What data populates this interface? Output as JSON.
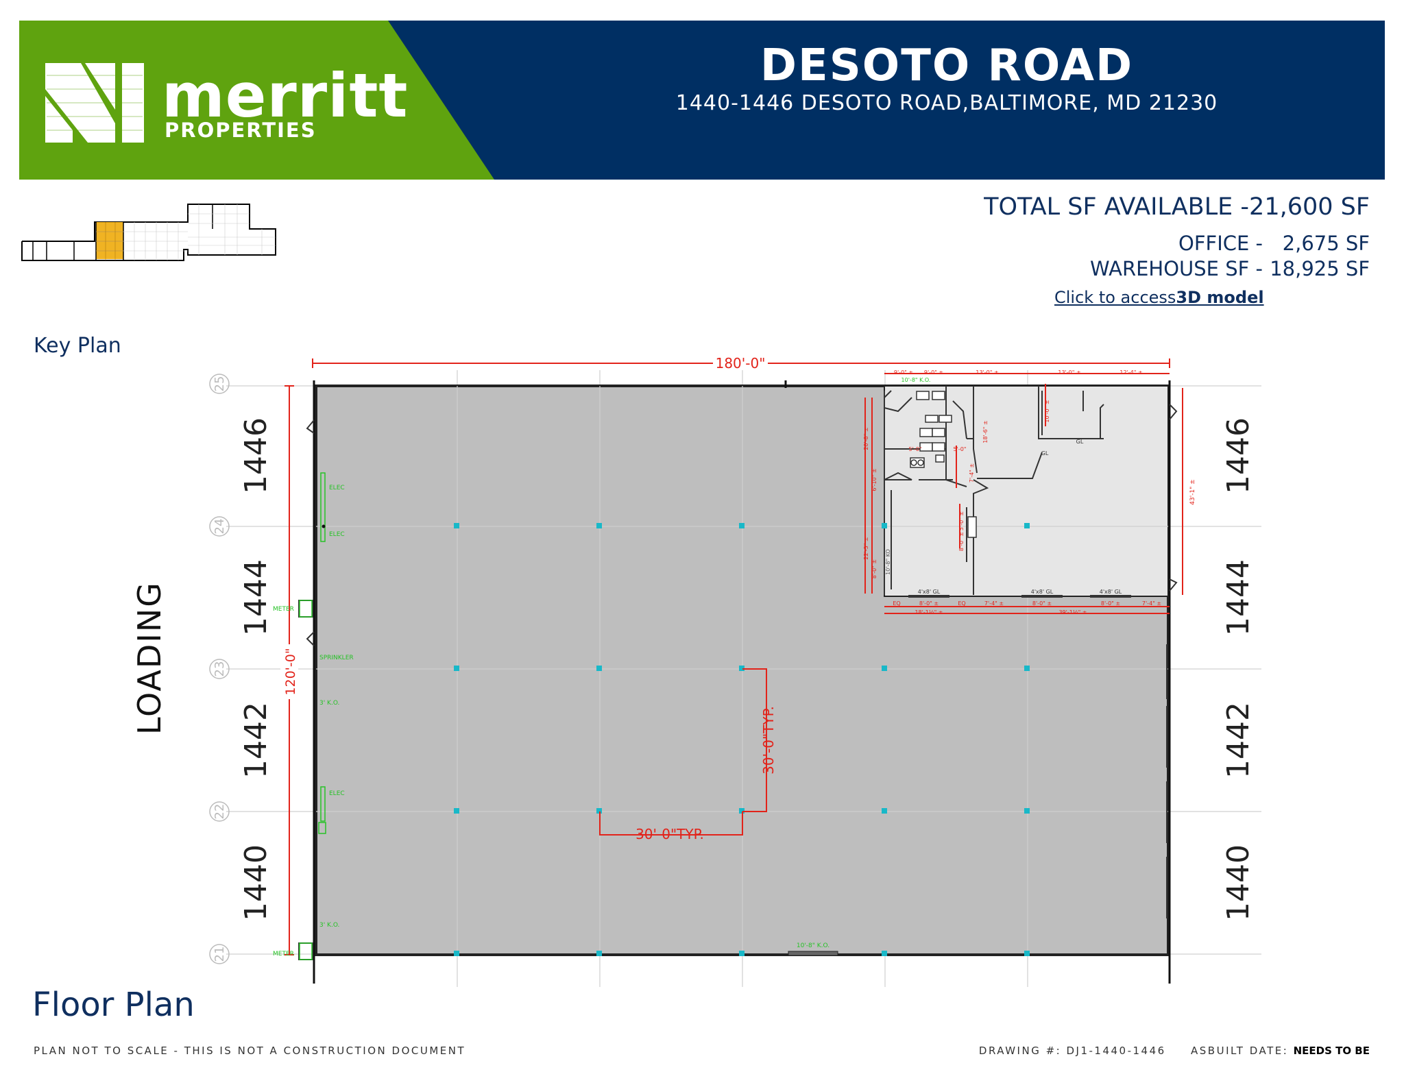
{
  "header": {
    "brand_name": "merritt",
    "brand_sub": "PROPERTIES",
    "title": "DESOTO ROAD",
    "address": "1440-1446 DESOTO ROAD,BALTIMORE, MD  21230",
    "colors": {
      "green": "#5fa30f",
      "navy": "#002f63"
    }
  },
  "summary": {
    "total": "TOTAL SF AVAILABLE -21,600 SF",
    "office_label": "OFFICE -",
    "office_value": "2,675 SF",
    "warehouse_label": "WAREHOUSE SF -",
    "warehouse_value": "18,925 SF",
    "link_prefix": "Click to access",
    "link_bold": "3D model"
  },
  "labels": {
    "key_plan": "Key Plan",
    "floor_plan": "Floor Plan",
    "loading": "LOADING"
  },
  "plan": {
    "overall_width": "180'-0\"",
    "overall_depth": "120'-0\"",
    "bay_typ_h": "30'-0\"TYP.",
    "bay_typ_v": "30'-0\"TYP.",
    "unit_numbers": [
      "1446",
      "1444",
      "1442",
      "1440"
    ],
    "grid_bubbles": [
      "25",
      "24",
      "23",
      "22",
      "21"
    ],
    "notes_left": [
      "ELEC",
      "ELEC",
      "METER",
      "SPRINKLER",
      "3' K.O.",
      "ELEC",
      "3' K.O.",
      "METER"
    ],
    "door_note": "10'-8\" K.O.",
    "office_dims_top": [
      "9'-0\" ±",
      "9'-0\" ±",
      "13'-0\" ±",
      "13'-0\" ±",
      "12'-4\" ±"
    ],
    "office_dims_bottom": [
      "EQ",
      "8'-0\" ±",
      "EQ",
      "7'-4\" ±",
      "8'-0\" ±",
      "8'-0\" ±",
      "7'-4\" ±"
    ],
    "office_dims_bottom2": [
      "18'-1½\" ±",
      "39'-1½\" ±"
    ],
    "window_labels": [
      "4'x8' GL",
      "4'x8' GL",
      "4'x8' GL"
    ],
    "office_right_dim": "43'-1\" ±",
    "office_top_note": "10'-8\" K.O.",
    "gl": "GL",
    "office_small": [
      "20'-8\" ±",
      "5'-0\"",
      "5'-0\"",
      "6'-10\" ±",
      "7'-4\" ±",
      "18'-6\" ±",
      "10'-0\" ±",
      "22'-3\" ±",
      "8'-0\" ±",
      "5'-0\" ±",
      "8'-0\" ±",
      "10'-8\" KO"
    ],
    "colors": {
      "floor": "#bebebe",
      "office": "#e6e6e6",
      "dim": "#e2231a",
      "column": "#19b8c8",
      "note": "#26c226",
      "keyplan_highlight": "#f0b323"
    }
  },
  "footer": {
    "left": "PLAN NOT TO SCALE - THIS IS NOT A CONSTRUCTION DOCUMENT",
    "drawing": "DRAWING #: DJ1-1440-1446",
    "asbuilt_label": "ASBUILT DATE:",
    "asbuilt_value": "NEEDS TO BE"
  }
}
